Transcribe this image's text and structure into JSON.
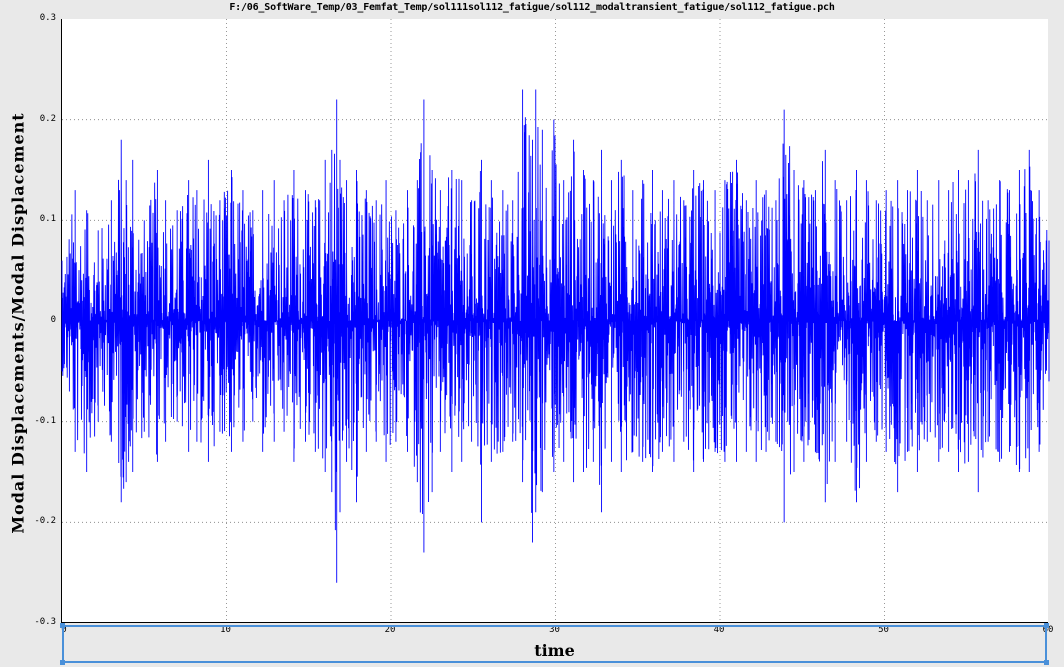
{
  "window": {
    "title": "F:/06_SoftWare_Temp/03_Femfat_Temp/sol111sol112_fatigue/sol112_modaltransient_fatigue/sol112_fatigue.pch"
  },
  "colors": {
    "series": "#0000ff",
    "grid": "#7f7f7f",
    "selection": "#4a90d9"
  },
  "chart_data": {
    "type": "line",
    "title": "",
    "xlabel": "time",
    "ylabel": "Modal Displacements/Modal Displacement",
    "xlim": [
      0,
      60
    ],
    "ylim": [
      -0.3,
      0.3
    ],
    "x_ticks": [
      "0",
      "10",
      "20",
      "30",
      "40",
      "50",
      "60"
    ],
    "y_ticks": [
      "0.3",
      "0.2",
      "0.1",
      "0",
      "-0.1",
      "-0.2",
      "-0.3"
    ],
    "grid": true,
    "series": [
      {
        "color": "#0000ff",
        "x": [
          0,
          0.8,
          1.5,
          2.2,
          3.0,
          3.6,
          3.9,
          4.3,
          5.0,
          5.8,
          6.3,
          7.0,
          7.7,
          8.2,
          8.9,
          9.6,
          10.3,
          11.0,
          11.6,
          12.2,
          12.9,
          13.5,
          14.1,
          14.8,
          15.4,
          16.0,
          16.4,
          16.7,
          16.9,
          17.3,
          17.9,
          18.5,
          19.1,
          19.7,
          20.3,
          21.0,
          21.6,
          22.0,
          22.5,
          23.0,
          23.7,
          24.3,
          24.9,
          25.5,
          26.1,
          26.8,
          27.4,
          28.0,
          28.6,
          28.8,
          29.2,
          29.9,
          30.5,
          31.1,
          31.7,
          32.3,
          32.8,
          33.4,
          34.0,
          34.7,
          35.3,
          35.9,
          36.5,
          37.2,
          37.8,
          38.4,
          39.0,
          39.7,
          40.3,
          41.0,
          41.6,
          42.2,
          42.8,
          43.4,
          43.9,
          44.5,
          45.1,
          45.8,
          46.4,
          47.0,
          47.7,
          48.3,
          48.9,
          49.5,
          50.1,
          50.8,
          51.4,
          52.0,
          52.6,
          53.3,
          53.9,
          54.5,
          55.1,
          55.7,
          56.3,
          57.0,
          57.6,
          58.2,
          58.8,
          59.4,
          60.0
        ],
        "y_max": [
          0.06,
          0.13,
          0.11,
          0.09,
          0.12,
          0.18,
          0.14,
          0.16,
          0.1,
          0.15,
          0.12,
          0.11,
          0.14,
          0.13,
          0.16,
          0.12,
          0.15,
          0.13,
          0.11,
          0.13,
          0.14,
          0.12,
          0.15,
          0.13,
          0.12,
          0.16,
          0.17,
          0.22,
          0.16,
          0.14,
          0.15,
          0.13,
          0.12,
          0.14,
          0.11,
          0.13,
          0.14,
          0.22,
          0.15,
          0.13,
          0.15,
          0.14,
          0.12,
          0.16,
          0.14,
          0.13,
          0.12,
          0.23,
          0.18,
          0.23,
          0.19,
          0.2,
          0.14,
          0.18,
          0.15,
          0.14,
          0.17,
          0.14,
          0.16,
          0.13,
          0.14,
          0.15,
          0.13,
          0.14,
          0.12,
          0.15,
          0.14,
          0.13,
          0.14,
          0.16,
          0.12,
          0.14,
          0.13,
          0.12,
          0.21,
          0.15,
          0.14,
          0.13,
          0.17,
          0.14,
          0.12,
          0.15,
          0.14,
          0.12,
          0.13,
          0.14,
          0.13,
          0.15,
          0.12,
          0.14,
          0.13,
          0.15,
          0.14,
          0.17,
          0.12,
          0.14,
          0.13,
          0.15,
          0.17,
          0.13,
          0.08
        ],
        "y_min": [
          -0.05,
          -0.13,
          -0.15,
          -0.1,
          -0.12,
          -0.18,
          -0.16,
          -0.15,
          -0.11,
          -0.14,
          -0.12,
          -0.1,
          -0.13,
          -0.12,
          -0.14,
          -0.11,
          -0.13,
          -0.12,
          -0.1,
          -0.13,
          -0.12,
          -0.11,
          -0.14,
          -0.12,
          -0.13,
          -0.15,
          -0.17,
          -0.26,
          -0.19,
          -0.14,
          -0.18,
          -0.13,
          -0.12,
          -0.14,
          -0.12,
          -0.13,
          -0.16,
          -0.23,
          -0.17,
          -0.13,
          -0.15,
          -0.14,
          -0.12,
          -0.2,
          -0.14,
          -0.13,
          -0.12,
          -0.16,
          -0.22,
          -0.19,
          -0.17,
          -0.15,
          -0.14,
          -0.16,
          -0.15,
          -0.14,
          -0.19,
          -0.14,
          -0.15,
          -0.13,
          -0.14,
          -0.15,
          -0.13,
          -0.14,
          -0.12,
          -0.15,
          -0.14,
          -0.13,
          -0.14,
          -0.14,
          -0.13,
          -0.14,
          -0.13,
          -0.12,
          -0.2,
          -0.15,
          -0.14,
          -0.13,
          -0.18,
          -0.14,
          -0.12,
          -0.18,
          -0.14,
          -0.12,
          -0.13,
          -0.17,
          -0.13,
          -0.15,
          -0.12,
          -0.14,
          -0.13,
          -0.15,
          -0.14,
          -0.17,
          -0.12,
          -0.14,
          -0.13,
          -0.15,
          -0.15,
          -0.13,
          -0.06
        ]
      }
    ]
  }
}
